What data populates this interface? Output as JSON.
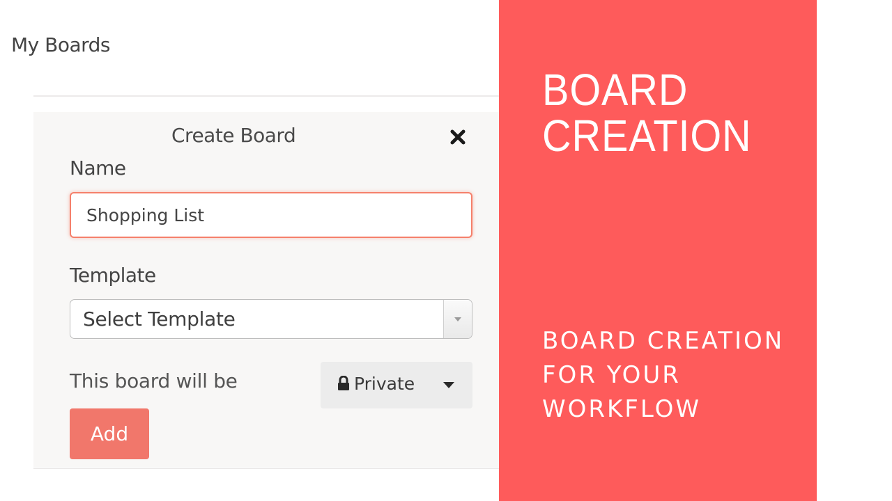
{
  "header": {
    "title": "My Boards"
  },
  "dialog": {
    "title": "Create Board",
    "close_icon": "close-icon",
    "name_label": "Name",
    "name_value": "Shopping List",
    "template_label": "Template",
    "template_selected": "Select Template",
    "visibility_text": "This board will be",
    "privacy_selected": "Private",
    "privacy_icon": "lock-icon",
    "add_label": "Add"
  },
  "hero": {
    "title": "BOARD CREATION",
    "subtitle": "BOARD CREATION FOR YOUR WORKFLOW"
  },
  "colors": {
    "accent": "#fe5b5b",
    "button": "#f1776b",
    "input_focus_border": "#f5806b",
    "panel_bg": "#f8f7f6"
  }
}
